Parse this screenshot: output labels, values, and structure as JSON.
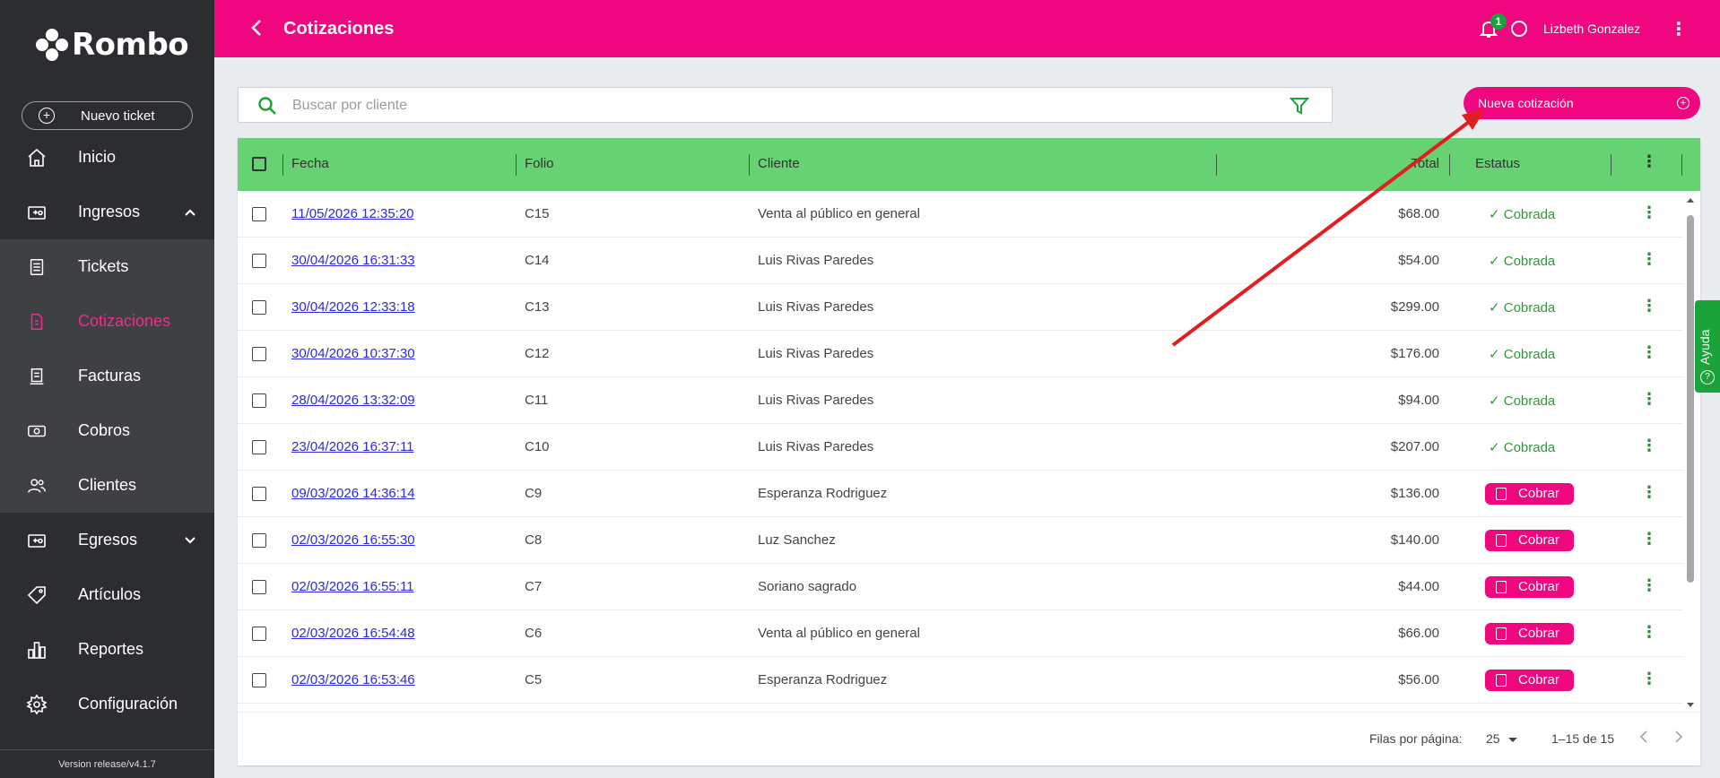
{
  "app": {
    "name": "Rombo"
  },
  "sidebar": {
    "new_ticket": "Nuevo ticket",
    "items": [
      {
        "label": "Inicio",
        "icon": "home-icon"
      },
      {
        "label": "Ingresos",
        "icon": "income-icon",
        "expanded": true
      },
      {
        "label": "Tickets",
        "icon": "ticket-icon"
      },
      {
        "label": "Cotizaciones",
        "icon": "quote-icon",
        "active": true
      },
      {
        "label": "Facturas",
        "icon": "invoice-icon"
      },
      {
        "label": "Cobros",
        "icon": "cash-icon"
      },
      {
        "label": "Clientes",
        "icon": "clients-icon"
      },
      {
        "label": "Egresos",
        "icon": "expenses-icon",
        "expanded": false
      },
      {
        "label": "Artículos",
        "icon": "tag-icon"
      },
      {
        "label": "Reportes",
        "icon": "reports-icon"
      },
      {
        "label": "Configuración",
        "icon": "gear-icon"
      }
    ],
    "version": "Version release/v4.1.7"
  },
  "header": {
    "title": "Cotizaciones",
    "notifications": "1",
    "user": "Lizbeth Gonzalez"
  },
  "search": {
    "placeholder": "Buscar por cliente"
  },
  "new_quote_button": "Nueva cotización",
  "table": {
    "columns": {
      "fecha": "Fecha",
      "folio": "Folio",
      "cliente": "Cliente",
      "total": "Total",
      "estatus": "Estatus"
    },
    "rows": [
      {
        "fecha": "11/05/2026  12:35:20",
        "folio": "C15",
        "cliente": "Venta al público en general",
        "total": "$68.00",
        "estatus": "✓ Cobrada",
        "paid": true
      },
      {
        "fecha": "30/04/2026  16:31:33",
        "folio": "C14",
        "cliente": "Luis Rivas Paredes",
        "total": "$54.00",
        "estatus": "✓ Cobrada",
        "paid": true
      },
      {
        "fecha": "30/04/2026  12:33:18",
        "folio": "C13",
        "cliente": "Luis Rivas Paredes",
        "total": "$299.00",
        "estatus": "✓ Cobrada",
        "paid": true
      },
      {
        "fecha": "30/04/2026  10:37:30",
        "folio": "C12",
        "cliente": "Luis Rivas Paredes",
        "total": "$176.00",
        "estatus": "✓ Cobrada",
        "paid": true
      },
      {
        "fecha": "28/04/2026  13:32:09",
        "folio": "C11",
        "cliente": "Luis Rivas Paredes",
        "total": "$94.00",
        "estatus": "✓ Cobrada",
        "paid": true
      },
      {
        "fecha": "23/04/2026  16:37:11",
        "folio": "C10",
        "cliente": "Luis Rivas Paredes",
        "total": "$207.00",
        "estatus": "✓ Cobrada",
        "paid": true
      },
      {
        "fecha": "09/03/2026  14:36:14",
        "folio": "C9",
        "cliente": "Esperanza Rodriguez",
        "total": "$136.00",
        "estatus": "Cobrar",
        "paid": false
      },
      {
        "fecha": "02/03/2026  16:55:30",
        "folio": "C8",
        "cliente": "Luz Sanchez",
        "total": "$140.00",
        "estatus": "Cobrar",
        "paid": false
      },
      {
        "fecha": "02/03/2026  16:55:11",
        "folio": "C7",
        "cliente": "Soriano sagrado",
        "total": "$44.00",
        "estatus": "Cobrar",
        "paid": false
      },
      {
        "fecha": "02/03/2026  16:54:48",
        "folio": "C6",
        "cliente": "Venta al público en general",
        "total": "$66.00",
        "estatus": "Cobrar",
        "paid": false
      },
      {
        "fecha": "02/03/2026  16:53:46",
        "folio": "C5",
        "cliente": "Esperanza Rodriguez",
        "total": "$56.00",
        "estatus": "Cobrar",
        "paid": false
      }
    ]
  },
  "pagination": {
    "rows_per_page_label": "Filas por página:",
    "rows_per_page": "25",
    "range": "1–15 de 15"
  },
  "help_tab": "Ayuda",
  "colors": {
    "brand": "#f0067e",
    "header_row": "#66d273",
    "sidebar": "#2b2d30"
  }
}
